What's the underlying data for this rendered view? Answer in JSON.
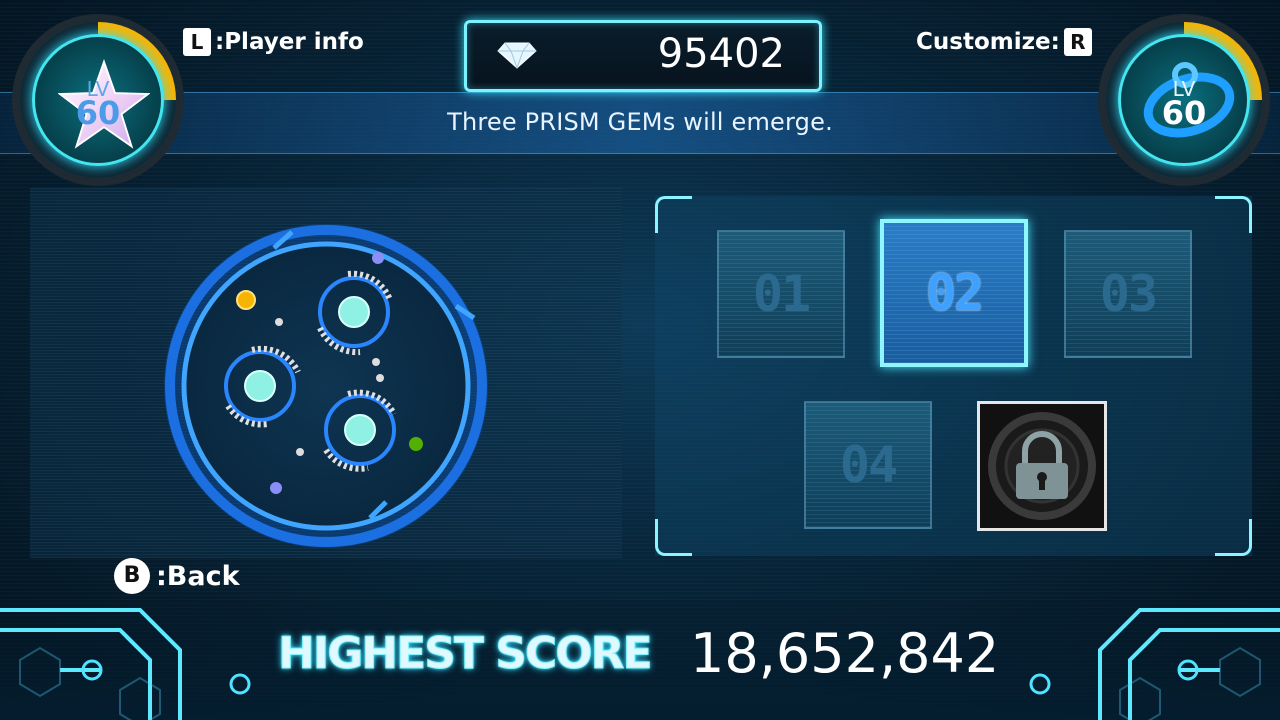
{
  "header": {
    "player_info_key": "L",
    "player_info_label": ":Player info",
    "customize_label": "Customize:",
    "customize_key": "R",
    "gem_count": "95402"
  },
  "player_level": {
    "lv_label": "LV",
    "value": "60",
    "ring_progress": 0.25
  },
  "partner_level": {
    "lv_label": "LV",
    "value": "60",
    "ring_progress": 0.25
  },
  "hint": {
    "text": "Three PRISM GEMs will emerge."
  },
  "stages": [
    {
      "label": "01",
      "selected": false,
      "locked": false
    },
    {
      "label": "02",
      "selected": true,
      "locked": false
    },
    {
      "label": "03",
      "selected": false,
      "locked": false
    },
    {
      "label": "04",
      "selected": false,
      "locked": false
    },
    {
      "label": "",
      "selected": false,
      "locked": true
    }
  ],
  "footer": {
    "back_key": "B",
    "back_label": ":Back",
    "highest_score_label": "HIGHEST SCORE",
    "highest_score_value": "18,652,842"
  },
  "colors": {
    "accent_cyan": "#7af3ff",
    "level_ring": "#f7b400",
    "selected_tile": "#2b7cc7",
    "preview_ring": "#1f7dff"
  },
  "icons": {
    "gem": "diamond-icon",
    "lock": "padlock-icon",
    "player_badge": "star-icon",
    "partner_badge": "swirl-icon"
  }
}
